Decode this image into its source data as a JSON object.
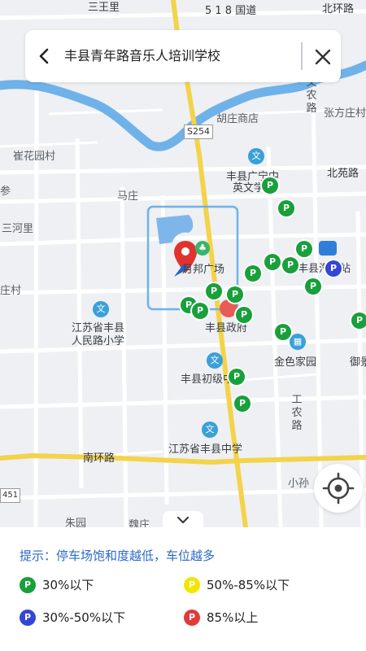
{
  "search": {
    "title": "丰县青年路音乐人培训学校"
  },
  "map": {
    "labels": {
      "road_518": "5 1 8 国道",
      "beihuan": "北环路",
      "cuihua": "崔花园村",
      "huzhuang": "胡庄商店",
      "s254": "S254",
      "zhangfang": "张方庄村",
      "beiyuan": "北苑路",
      "mazhuang": "马庄",
      "sanhe": "三河里",
      "zhuang": "庄村",
      "guangcheng_pre": "丰县广宁中",
      "guangcheng_sub": "英文学校",
      "yuebang": "月邦广场",
      "station": "丰县汽车站",
      "jiangsu1_line1": "江苏省丰县",
      "jiangsu1_line2": "人民路小学",
      "zhengfu": "丰县政府",
      "jinse": "金色家园",
      "yujing": "御景",
      "chuji": "丰县初级中学",
      "gongnong": "工农路",
      "wenhua": "文农路",
      "jiangsu2": "江苏省丰县中学",
      "nanhuan": "南环路",
      "xiaosun": "小孙",
      "code451": "451",
      "zhuyuan": "朱园",
      "bottom_lbl": "魏庄",
      "top_left": "三王里",
      "left_edge": "参"
    }
  },
  "panel": {
    "hint": "提示：停车场饱和度越低，车位越多",
    "legend": [
      {
        "label": "30%以下",
        "color": "#18a03a",
        "glyph": "P"
      },
      {
        "label": "50%-85%以下",
        "color": "#f2e600",
        "glyph": "P"
      },
      {
        "label": "30%-50%以下",
        "color": "#3346d6",
        "glyph": "P"
      },
      {
        "label": "85%以上",
        "color": "#e03a3a",
        "glyph": "P"
      }
    ]
  },
  "icons": {
    "back": "chevron-left-icon",
    "close": "close-icon",
    "locate": "locate-crosshair-icon",
    "collapse": "chevron-down-icon",
    "poi_school": "school-icon",
    "parking": "parking-icon",
    "location_marker": "location-pin-icon"
  },
  "colors": {
    "green": "#18a03a",
    "blue": "#3346d6",
    "yellow": "#f2e600",
    "red": "#e03a3a",
    "river": "#6fb2ea",
    "arterial": "#f3d34a",
    "accent": "#2b68c8"
  }
}
